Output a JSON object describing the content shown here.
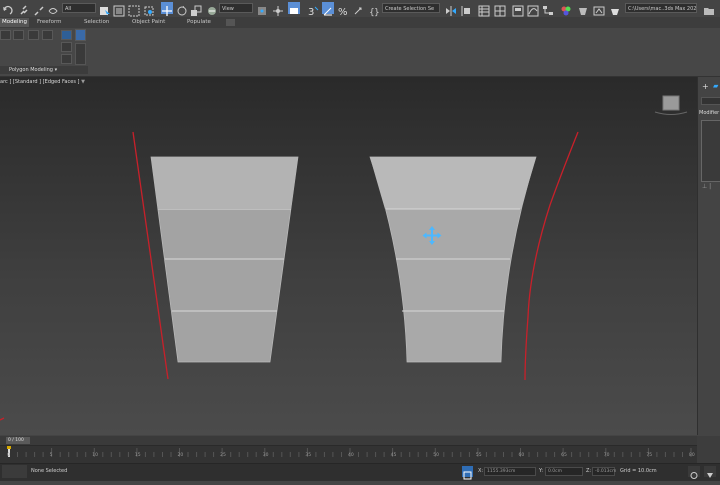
{
  "main_toolbar": {
    "selection_filter": "All",
    "ref_coord": "View",
    "named_selection_placeholder": "Create Selection Se",
    "project_path": "C:\\Users\\mac..3ds Max 2023"
  },
  "ribbon_tabs": [
    {
      "label": "Modeling",
      "active": true
    },
    {
      "label": "Freeform",
      "active": false
    },
    {
      "label": "Selection",
      "active": false
    },
    {
      "label": "Object Paint",
      "active": false
    },
    {
      "label": "Populate",
      "active": false
    }
  ],
  "ribbon": {
    "panel_label": "Polygon Modeling"
  },
  "viewport": {
    "label": "[+] [Front] [Standard] [Edged Faces]",
    "label_visible": "arc ] [Standard ] [Edged Faces ]",
    "filter_icon": "funnel-icon",
    "colors": {
      "mesh": "#b3b3b3",
      "spline": "#c8202a",
      "gizmo": "#4db8ff"
    }
  },
  "command_panel": {
    "tab_label": "Modifier"
  },
  "timeline": {
    "slider_text": "0 / 100",
    "ticks": [
      "0",
      "5",
      "10",
      "15",
      "20",
      "25",
      "30",
      "35",
      "40",
      "45",
      "50",
      "55",
      "60",
      "65",
      "70",
      "75",
      "80"
    ]
  },
  "status": {
    "selection": "None Selected",
    "x_label": "X:",
    "x_value": "1155.393cm",
    "y_label": "Y:",
    "y_value": "0.0cm",
    "z_label": "Z:",
    "z_value": "-0.013cm",
    "grid": "Grid = 10.0cm"
  }
}
